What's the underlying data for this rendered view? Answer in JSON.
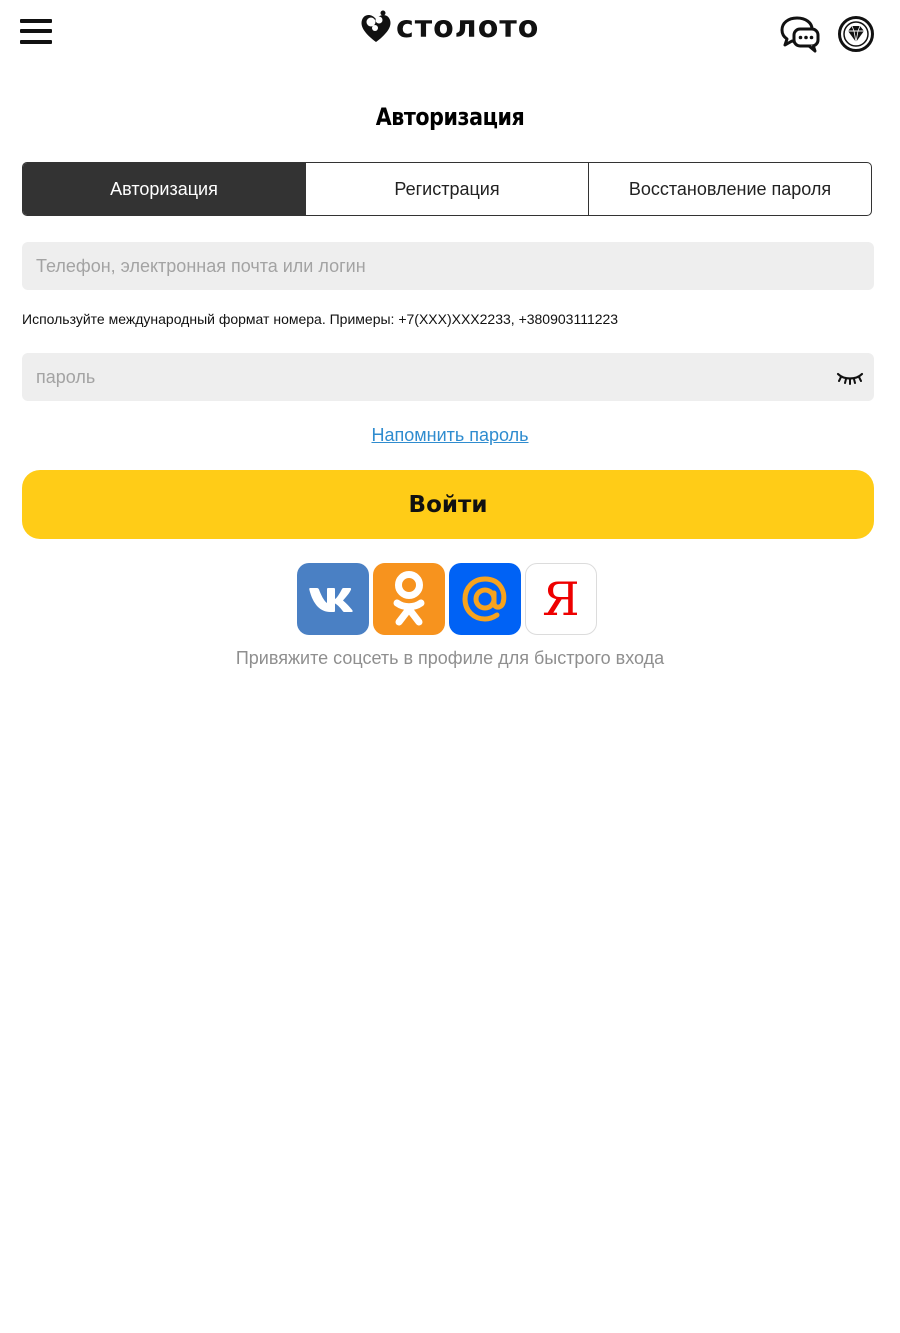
{
  "header": {
    "menu_icon": "hamburger-menu-icon",
    "logo_text": "столото",
    "logo_icon": "heart-clover-logo-icon",
    "chat_icon": "chat-bubbles-icon",
    "gem_icon": "diamond-icon"
  },
  "page": {
    "title": "Авторизация"
  },
  "tabs": [
    {
      "label": "Авторизация",
      "active": true
    },
    {
      "label": "Регистрация",
      "active": false
    },
    {
      "label": "Восстановление пароля",
      "active": false
    }
  ],
  "form": {
    "login": {
      "value": "",
      "placeholder": "Телефон, электронная почта или логин"
    },
    "hint": "Используйте международный формат номера. Примеры: +7(XXX)XXX2233, +380903111223",
    "password": {
      "value": "",
      "placeholder": "пароль",
      "toggle_icon": "eye-closed-icon"
    },
    "remind_link": "Напомнить пароль",
    "submit_label": "Войти"
  },
  "social": {
    "items": [
      {
        "name": "vk",
        "icon": "vk-icon",
        "color": "#4a80c4"
      },
      {
        "name": "odnoklassniki",
        "icon": "odnoklassniki-icon",
        "color": "#f7931e"
      },
      {
        "name": "mail",
        "icon": "mail-at-icon",
        "color": "#0062f5"
      },
      {
        "name": "yandex",
        "icon": "yandex-icon",
        "letter": "Я",
        "color": "#ee0000"
      }
    ],
    "note": "Привяжите соцсеть в профиле для быстрого входа"
  },
  "colors": {
    "accent": "#ffcc17",
    "tab_active_bg": "#333333",
    "link": "#2f8ccf",
    "input_bg": "#eeeeee"
  }
}
